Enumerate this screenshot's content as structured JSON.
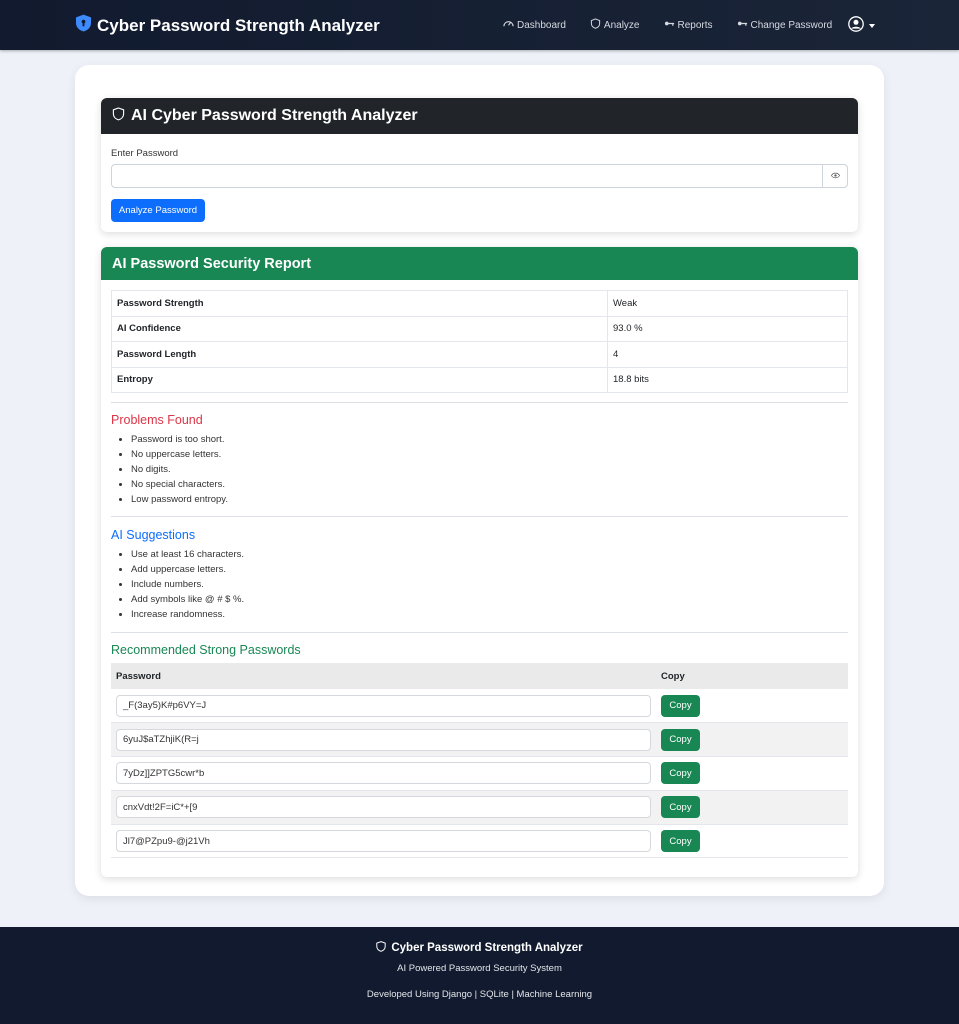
{
  "navbar": {
    "brand": "Cyber Password Strength Analyzer",
    "links": [
      {
        "label": "Dashboard",
        "icon": "speedometer-icon"
      },
      {
        "label": "Analyze",
        "icon": "shield-icon"
      },
      {
        "label": "Reports",
        "icon": "key-icon"
      },
      {
        "label": "Change Password",
        "icon": "key-icon"
      }
    ]
  },
  "analyzer": {
    "title": "AI Cyber Password Strength Analyzer",
    "label": "Enter Password",
    "password_value": "",
    "analyze_label": "Analyze Password"
  },
  "report": {
    "title": "AI Password Security Report",
    "rows": [
      {
        "key": "Password Strength",
        "value": "Weak"
      },
      {
        "key": "AI Confidence",
        "value": "93.0 %"
      },
      {
        "key": "Password Length",
        "value": "4"
      },
      {
        "key": "Entropy",
        "value": "18.8 bits"
      }
    ],
    "problems_title": "Problems Found",
    "problems": [
      "Password is too short.",
      "No uppercase letters.",
      "No digits.",
      "No special characters.",
      "Low password entropy."
    ],
    "suggestions_title": "AI Suggestions",
    "suggestions": [
      "Use at least 16 characters.",
      "Add uppercase letters.",
      "Include numbers.",
      "Add symbols like @ # $ %.",
      "Increase randomness."
    ],
    "recommended_title": "Recommended Strong Passwords",
    "table_headers": [
      "Password",
      "Copy"
    ],
    "copy_label": "Copy",
    "passwords": [
      "_F(3ay5)K#p6VY=J",
      "6yuJ$aTZhjiK(R=j",
      "7yDz]]ZPTG5cwr*b",
      "cnxVdt!2F=iC*+[9",
      "Jl7@PZpu9-@j21Vh"
    ]
  },
  "footer": {
    "title": "Cyber Password Strength Analyzer",
    "subtitle": "AI Powered Password Security System",
    "developed": "Developed Using Django | SQLite | Machine Learning"
  },
  "colors": {
    "navbar": "#111a2e",
    "primary": "#0d6efd",
    "success": "#198754",
    "danger": "#dc3545",
    "dark": "#212529"
  }
}
